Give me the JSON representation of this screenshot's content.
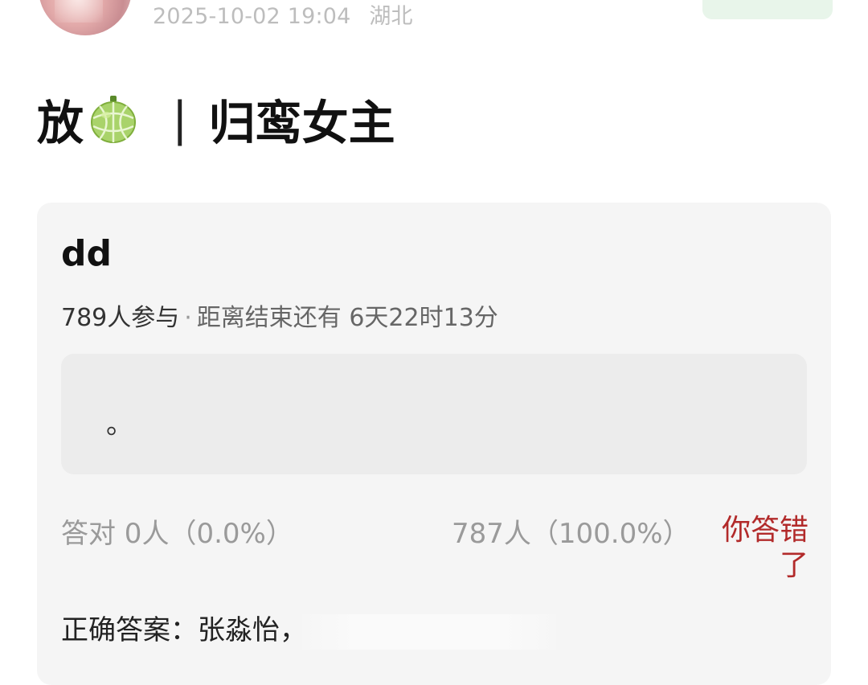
{
  "post": {
    "datetime": "2025-10-02 19:04",
    "location": "湖北",
    "title_prefix": "放",
    "title_separator": "|",
    "title_main": "归鸾女主",
    "title_icon": "melon-emoji"
  },
  "quiz": {
    "title": "dd",
    "participants": "789人参与",
    "separator": "·",
    "remaining": "距离结束还有 6天22时13分",
    "question": "。",
    "correct_stats": "答对  0人（0.0%）",
    "wrong_stats": "787人（100.0%）",
    "result": "你答错了",
    "answer": "正确答案：张淼怡，"
  },
  "colors": {
    "result_red": "#b22a2a",
    "follow_green": "#e8f5ea",
    "card_bg": "#f5f5f5"
  }
}
